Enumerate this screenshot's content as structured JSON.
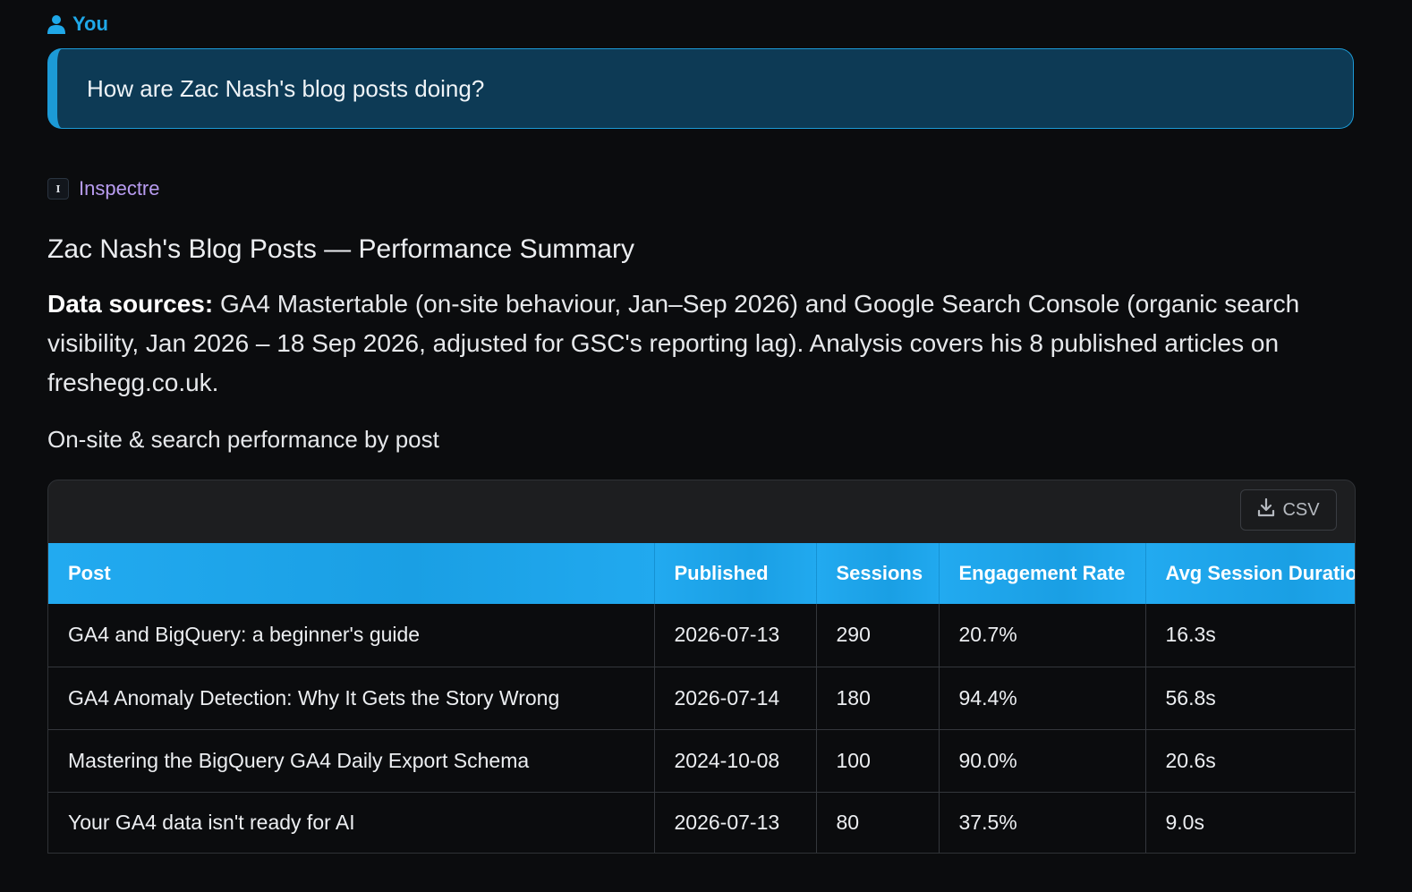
{
  "user": {
    "label": "You",
    "icon": "user-icon"
  },
  "prompt": {
    "text": "How are Zac Nash's blog posts doing?"
  },
  "assistant": {
    "logo_letter": "I",
    "name": "Inspectre"
  },
  "response": {
    "title": "Zac Nash's Blog Posts — Performance Summary",
    "sources_label": "Data sources:",
    "sources_text": " GA4 Mastertable (on-site behaviour, Jan–Sep 2026) and Google Search Console (organic search visibility, Jan 2026 – 18 Sep 2026, adjusted for GSC's reporting lag). Analysis covers his 8 published articles on freshegg.co.uk.",
    "table_caption": "On-site & search performance by post"
  },
  "table": {
    "export_label": "CSV",
    "export_icon": "download-icon",
    "columns": [
      "Post",
      "Published",
      "Sessions",
      "Engagement Rate",
      "Avg Session Duration"
    ],
    "rows": [
      [
        "GA4 and BigQuery: a beginner's guide",
        "2026-07-13",
        "290",
        "20.7%",
        "16.3s"
      ],
      [
        "GA4 Anomaly Detection: Why It Gets the Story Wrong",
        "2026-07-14",
        "180",
        "94.4%",
        "56.8s"
      ],
      [
        "Mastering the BigQuery GA4 Daily Export Schema",
        "2024-10-08",
        "100",
        "90.0%",
        "20.6s"
      ],
      [
        "Your GA4 data isn't ready for AI",
        "2026-07-13",
        "80",
        "37.5%",
        "9.0s"
      ]
    ]
  },
  "colors": {
    "background": "#0b0c0e",
    "accent": "#1fa8e8",
    "prompt_bg": "#0d3a55",
    "assistant_name": "#b89cf0",
    "table_header": "#22aaf0"
  }
}
